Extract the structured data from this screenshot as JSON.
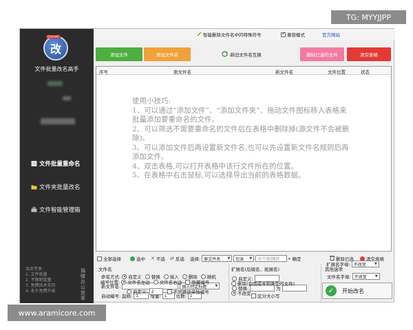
{
  "watermarks": {
    "tg": "TG: MYYJJPP",
    "site": "www.aramicore.com"
  },
  "sidebar": {
    "logo_badge": "RENAME",
    "logo_glyph": "改",
    "title": "文件批量改名高手",
    "items": [
      {
        "label": "文件批量重命名",
        "icon": "document-icon"
      },
      {
        "label": "文件夹批量改名",
        "icon": "folder-icon"
      },
      {
        "label": "文件智能管理箱",
        "icon": "toolbox-icon"
      }
    ],
    "notes": [
      "会员专享:",
      "1. 文件批量",
      "2. 不限制批量",
      "3. 免费技术支持",
      "4. 永久免费升级"
    ],
    "vertical_text": "捐赠办公效率"
  },
  "topbar": {
    "smart_remove": "智能删除文件名中的特殊符号",
    "compat_mode": "兼容模式",
    "website": "官方网站"
  },
  "toolbar": {
    "add_file": "添加文件",
    "add_folder": "添加文件夹",
    "new_name_rule": "新旧文件名互换",
    "delete_selected": "删除已选的文件",
    "clear_table": "清空表格"
  },
  "table": {
    "columns": [
      "序号",
      "原文件名",
      "新文件名",
      "文件位置",
      "状态"
    ],
    "tips_title": "使用小技巧:",
    "tips": [
      "1、可以通过“添加文件”、“添加文件夹”、拖动文件图标移入表格来批量添加要重命名的文件。",
      "2、可以筛选不需要重命名的文件后在表格中删除掉(源文件不会被删除)。",
      "3、可以添加文件后再设置新文件名,也可以先设置新文件名规则后再添加文件。",
      "4、双击表格,可以打开表格中该行文件所在的位置。",
      "5、在表格中右击鼠标,可以选择导出当前的表格数据。"
    ]
  },
  "filter_row": {
    "select_all": "全部选择",
    "select": "选中",
    "deselect": "不选",
    "invert": "反选",
    "choose": "选择:",
    "field": "原文件名",
    "op": "包含",
    "placeholder": "多个用|隔开",
    "confirm": "确定",
    "delete_selected": "删除已选",
    "clear_table": "清空表格"
  },
  "filename_panel": {
    "title": "文件名",
    "naming_label": "命名方式:",
    "modes": [
      "自定义",
      "替换",
      "插入",
      "删除",
      "随机"
    ],
    "new_name_label": "新文件名:",
    "insert_placeholder": "插入特定标题",
    "seq_label": "自动编号:",
    "start_label": "起始:",
    "start_val": "1",
    "step_label": "增量:",
    "step_val": "1",
    "digits_label": "位数:",
    "digits_val": "1",
    "pos_label": "编号位置:",
    "pos_left": "文件名左边",
    "pos_right": "文件名右边",
    "hide_num": "隐藏编号",
    "custom_label": "自定义:",
    "custom_val": "2",
    "no_repeat": "不同路径单独编号"
  },
  "ext_panel": {
    "title": "扩展名(后缀名、拓展名)",
    "custom": "自定义:",
    "replace": "替换:",
    "as_label": "为",
    "case_sensitive": "区分大小写",
    "delete_ext": "删除(会因成本和类型的文件)",
    "unchanged": "不改变"
  },
  "other_panel": {
    "title": "其他选项",
    "name_case_label": "文件名字母:",
    "name_case_val": "不改变",
    "ext_case_label": "扩展名字母:",
    "ext_case_val": "不改变",
    "start_button": "开始改名"
  }
}
